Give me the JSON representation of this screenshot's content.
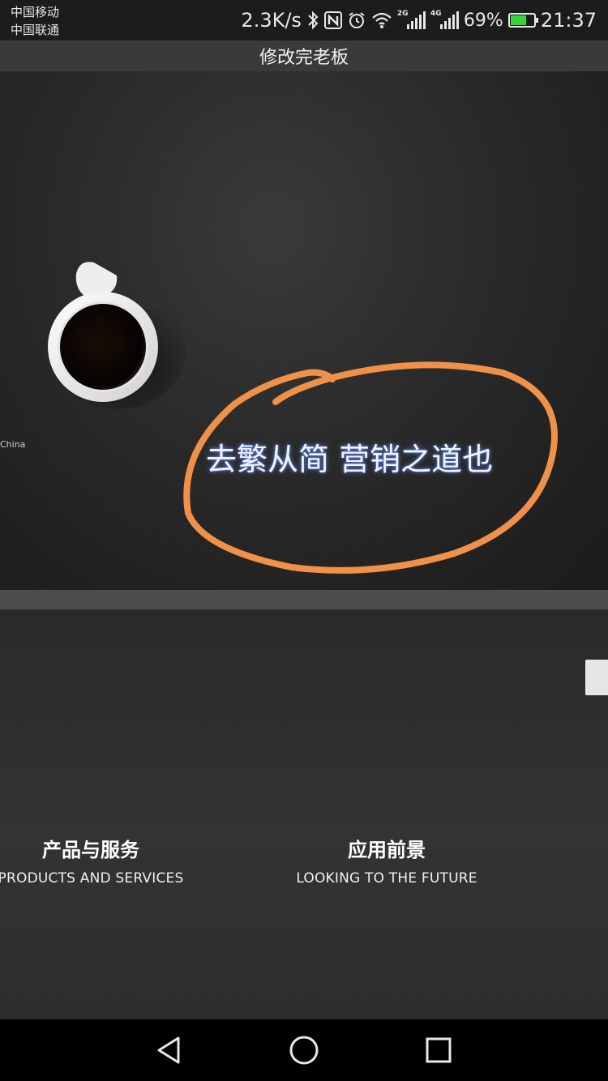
{
  "status_bar": {
    "carrier_1": "中国移动",
    "carrier_2": "中国联通",
    "net_speed": "2.3K/s",
    "sim1_tag": "2G",
    "sim2_tag": "4G",
    "battery_percent": "69%",
    "battery_level": 0.69,
    "time": "21:37",
    "icons": [
      "bluetooth-icon",
      "nfc-icon",
      "alarm-icon",
      "wifi-icon",
      "signal-icon",
      "signal-icon",
      "battery-icon"
    ]
  },
  "title_bar": {
    "title": "修改完老板"
  },
  "hero": {
    "side_label": "China",
    "slogan": "去繁从简 营销之道也",
    "annotation_color": "#f0914a"
  },
  "features": [
    {
      "title": "产品与服务",
      "subtitle": "PRODUCTS AND SERVICES"
    },
    {
      "title": "应用前景",
      "subtitle": "LOOKING TO THE FUTURE"
    }
  ],
  "nav_bar": {
    "icons": [
      "back-icon",
      "home-icon",
      "recent-apps-icon"
    ]
  },
  "colors": {
    "accent_orange": "#f0914a",
    "battery_green": "#36d33a"
  }
}
